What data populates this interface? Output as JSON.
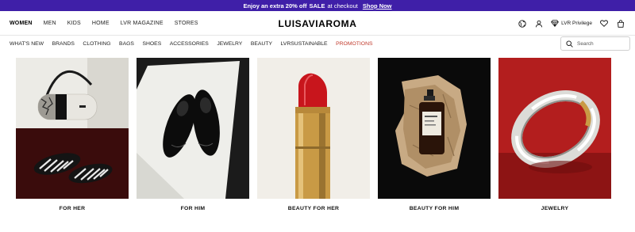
{
  "promo": {
    "lead": "Enjoy an extra 20% off",
    "highlight": "SALE",
    "trail": "at checkout",
    "link": "Shop Now"
  },
  "header": {
    "gender_tabs": [
      {
        "label": "WOMEN",
        "active": true
      },
      {
        "label": "MEN"
      },
      {
        "label": "KIDS"
      },
      {
        "label": "HOME"
      },
      {
        "label": "LVR MAGAZINE"
      },
      {
        "label": "STORES"
      }
    ],
    "logo": "LUISAVIAROMA",
    "privilege_label": "LVR Privilege",
    "icons": [
      "globe-icon",
      "user-icon",
      "diamond-icon",
      "heart-icon",
      "shopping-bag-icon"
    ]
  },
  "categories": {
    "items": [
      "WHAT'S NEW",
      "BRANDS",
      "CLOTHING",
      "BAGS",
      "SHOES",
      "ACCESSORIES",
      "JEWELRY",
      "BEAUTY",
      "LVRSUSTAINABLE"
    ],
    "promotions": "PROMOTIONS",
    "promotions_color": "#c0392b"
  },
  "search": {
    "placeholder": "Search"
  },
  "tiles": [
    {
      "caption": "FOR HER"
    },
    {
      "caption": "FOR HIM"
    },
    {
      "caption": "BEAUTY FOR HER"
    },
    {
      "caption": "BEAUTY FOR HIM"
    },
    {
      "caption": "JEWELRY"
    }
  ],
  "colors": {
    "promo_bar": "#3f1fa8",
    "accent_red": "#c0392b"
  }
}
